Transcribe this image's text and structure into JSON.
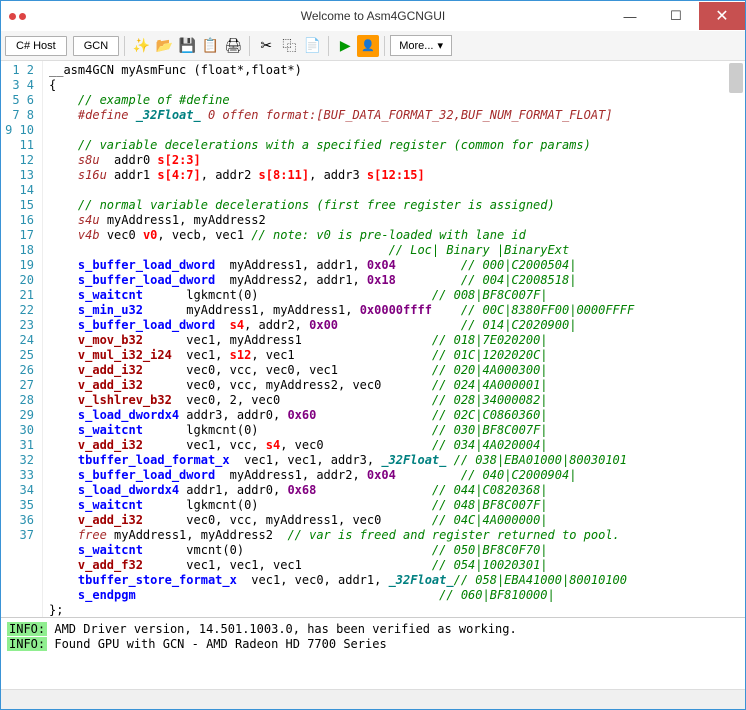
{
  "window": {
    "title": "Welcome to Asm4GCNGUI"
  },
  "toolbar": {
    "tab1": "C# Host",
    "tab2": "GCN",
    "more": "More..."
  },
  "gutter_max": 37,
  "code_lines": [
    [
      {
        "t": "__asm4GCN myAsmFunc (float*,float*)",
        "c": ""
      }
    ],
    [
      {
        "t": "{",
        "c": ""
      }
    ],
    [
      {
        "t": "    ",
        "c": ""
      },
      {
        "t": "// example of #define",
        "c": "sc-green"
      }
    ],
    [
      {
        "t": "    ",
        "c": ""
      },
      {
        "t": "#define ",
        "c": "sc-brown"
      },
      {
        "t": "_32Float_",
        "c": "sc-teal"
      },
      {
        "t": " 0 offen format:[BUF_DATA_FORMAT_32,BUF_NUM_FORMAT_FLOAT]",
        "c": "sc-brown"
      }
    ],
    [
      {
        "t": "",
        "c": ""
      }
    ],
    [
      {
        "t": "    ",
        "c": ""
      },
      {
        "t": "// variable decelerations with a specified register (common for params)",
        "c": "sc-green"
      }
    ],
    [
      {
        "t": "    ",
        "c": ""
      },
      {
        "t": "s8u",
        "c": "sc-brown"
      },
      {
        "t": "  addr0 ",
        "c": ""
      },
      {
        "t": "s[2:3]",
        "c": "sc-s"
      }
    ],
    [
      {
        "t": "    ",
        "c": ""
      },
      {
        "t": "s16u",
        "c": "sc-brown"
      },
      {
        "t": " addr1 ",
        "c": ""
      },
      {
        "t": "s[4:7]",
        "c": "sc-s"
      },
      {
        "t": ", addr2 ",
        "c": ""
      },
      {
        "t": "s[8:11]",
        "c": "sc-s"
      },
      {
        "t": ", addr3 ",
        "c": ""
      },
      {
        "t": "s[12:15]",
        "c": "sc-s"
      }
    ],
    [
      {
        "t": "",
        "c": ""
      }
    ],
    [
      {
        "t": "    ",
        "c": ""
      },
      {
        "t": "// normal variable decelerations (first free register is assigned)",
        "c": "sc-green"
      }
    ],
    [
      {
        "t": "    ",
        "c": ""
      },
      {
        "t": "s4u",
        "c": "sc-brown"
      },
      {
        "t": " myAddress1, myAddress2",
        "c": ""
      }
    ],
    [
      {
        "t": "    ",
        "c": ""
      },
      {
        "t": "v4b",
        "c": "sc-brown"
      },
      {
        "t": " vec0 ",
        "c": ""
      },
      {
        "t": "v0",
        "c": "sc-s"
      },
      {
        "t": ", vecb, vec1 ",
        "c": ""
      },
      {
        "t": "// note: v0 is pre-loaded with lane id",
        "c": "sc-green"
      }
    ],
    [
      {
        "t": "                                               ",
        "c": ""
      },
      {
        "t": "// Loc| Binary |BinaryExt",
        "c": "sc-green"
      }
    ],
    [
      {
        "t": "    ",
        "c": ""
      },
      {
        "t": "s_buffer_load_dword",
        "c": "sc-kw"
      },
      {
        "t": "  myAddress1, addr1, ",
        "c": ""
      },
      {
        "t": "0x04",
        "c": "sc-num"
      },
      {
        "t": "         ",
        "c": ""
      },
      {
        "t": "// 000|C2000504|",
        "c": "sc-green"
      }
    ],
    [
      {
        "t": "    ",
        "c": ""
      },
      {
        "t": "s_buffer_load_dword",
        "c": "sc-kw"
      },
      {
        "t": "  myAddress2, addr1, ",
        "c": ""
      },
      {
        "t": "0x18",
        "c": "sc-num"
      },
      {
        "t": "         ",
        "c": ""
      },
      {
        "t": "// 004|C2008518|",
        "c": "sc-green"
      }
    ],
    [
      {
        "t": "    ",
        "c": ""
      },
      {
        "t": "s_waitcnt",
        "c": "sc-kw"
      },
      {
        "t": "      lgkmcnt(0)                        ",
        "c": ""
      },
      {
        "t": "// 008|BF8C007F|",
        "c": "sc-green"
      }
    ],
    [
      {
        "t": "    ",
        "c": ""
      },
      {
        "t": "s_min_u32",
        "c": "sc-kw"
      },
      {
        "t": "      myAddress1, myAddress1, ",
        "c": ""
      },
      {
        "t": "0x0000ffff",
        "c": "sc-num"
      },
      {
        "t": "    ",
        "c": ""
      },
      {
        "t": "// 00C|8380FF00|0000FFFF",
        "c": "sc-green"
      }
    ],
    [
      {
        "t": "    ",
        "c": ""
      },
      {
        "t": "s_buffer_load_dword",
        "c": "sc-kw"
      },
      {
        "t": "  ",
        "c": ""
      },
      {
        "t": "s4",
        "c": "sc-s"
      },
      {
        "t": ", addr2, ",
        "c": ""
      },
      {
        "t": "0x00",
        "c": "sc-num"
      },
      {
        "t": "                 ",
        "c": ""
      },
      {
        "t": "// 014|C2020900|",
        "c": "sc-green"
      }
    ],
    [
      {
        "t": "    ",
        "c": ""
      },
      {
        "t": "v_mov_b32",
        "c": "sc-red"
      },
      {
        "t": "      vec1, myAddress1                  ",
        "c": ""
      },
      {
        "t": "// 018|7E020200|",
        "c": "sc-green"
      }
    ],
    [
      {
        "t": "    ",
        "c": ""
      },
      {
        "t": "v_mul_i32_i24",
        "c": "sc-red"
      },
      {
        "t": "  vec1, ",
        "c": ""
      },
      {
        "t": "s12",
        "c": "sc-s"
      },
      {
        "t": ", vec1                   ",
        "c": ""
      },
      {
        "t": "// 01C|1202020C|",
        "c": "sc-green"
      }
    ],
    [
      {
        "t": "    ",
        "c": ""
      },
      {
        "t": "v_add_i32",
        "c": "sc-red"
      },
      {
        "t": "      vec0, vcc, vec0, vec1             ",
        "c": ""
      },
      {
        "t": "// 020|4A000300|",
        "c": "sc-green"
      }
    ],
    [
      {
        "t": "    ",
        "c": ""
      },
      {
        "t": "v_add_i32",
        "c": "sc-red"
      },
      {
        "t": "      vec0, vcc, myAddress2, vec0       ",
        "c": ""
      },
      {
        "t": "// 024|4A000001|",
        "c": "sc-green"
      }
    ],
    [
      {
        "t": "    ",
        "c": ""
      },
      {
        "t": "v_lshlrev_b32",
        "c": "sc-red"
      },
      {
        "t": "  vec0, 2, vec0                     ",
        "c": ""
      },
      {
        "t": "// 028|34000082|",
        "c": "sc-green"
      }
    ],
    [
      {
        "t": "    ",
        "c": ""
      },
      {
        "t": "s_load_dwordx4",
        "c": "sc-kw"
      },
      {
        "t": " addr3, addr0, ",
        "c": ""
      },
      {
        "t": "0x60",
        "c": "sc-num"
      },
      {
        "t": "                ",
        "c": ""
      },
      {
        "t": "// 02C|C0860360|",
        "c": "sc-green"
      }
    ],
    [
      {
        "t": "    ",
        "c": ""
      },
      {
        "t": "s_waitcnt",
        "c": "sc-kw"
      },
      {
        "t": "      lgkmcnt(0)                        ",
        "c": ""
      },
      {
        "t": "// 030|BF8C007F|",
        "c": "sc-green"
      }
    ],
    [
      {
        "t": "    ",
        "c": ""
      },
      {
        "t": "v_add_i32",
        "c": "sc-red"
      },
      {
        "t": "      vec1, vcc, ",
        "c": ""
      },
      {
        "t": "s4",
        "c": "sc-s"
      },
      {
        "t": ", vec0               ",
        "c": ""
      },
      {
        "t": "// 034|4A020004|",
        "c": "sc-green"
      }
    ],
    [
      {
        "t": "    ",
        "c": ""
      },
      {
        "t": "tbuffer_load_format_x",
        "c": "sc-kw"
      },
      {
        "t": "  vec1, vec1, addr3, ",
        "c": ""
      },
      {
        "t": "_32Float_",
        "c": "sc-teal"
      },
      {
        "t": " ",
        "c": ""
      },
      {
        "t": "// 038|EBA01000|80030101",
        "c": "sc-green"
      }
    ],
    [
      {
        "t": "    ",
        "c": ""
      },
      {
        "t": "s_buffer_load_dword",
        "c": "sc-kw"
      },
      {
        "t": "  myAddress1, addr2, ",
        "c": ""
      },
      {
        "t": "0x04",
        "c": "sc-num"
      },
      {
        "t": "         ",
        "c": ""
      },
      {
        "t": "// 040|C2000904|",
        "c": "sc-green"
      }
    ],
    [
      {
        "t": "    ",
        "c": ""
      },
      {
        "t": "s_load_dwordx4",
        "c": "sc-kw"
      },
      {
        "t": " addr1, addr0, ",
        "c": ""
      },
      {
        "t": "0x68",
        "c": "sc-num"
      },
      {
        "t": "                ",
        "c": ""
      },
      {
        "t": "// 044|C0820368|",
        "c": "sc-green"
      }
    ],
    [
      {
        "t": "    ",
        "c": ""
      },
      {
        "t": "s_waitcnt",
        "c": "sc-kw"
      },
      {
        "t": "      lgkmcnt(0)                        ",
        "c": ""
      },
      {
        "t": "// 048|BF8C007F|",
        "c": "sc-green"
      }
    ],
    [
      {
        "t": "    ",
        "c": ""
      },
      {
        "t": "v_add_i32",
        "c": "sc-red"
      },
      {
        "t": "      vec0, vcc, myAddress1, vec0       ",
        "c": ""
      },
      {
        "t": "// 04C|4A000000|",
        "c": "sc-green"
      }
    ],
    [
      {
        "t": "    ",
        "c": ""
      },
      {
        "t": "free",
        "c": "sc-brown"
      },
      {
        "t": " myAddress1, myAddress2  ",
        "c": ""
      },
      {
        "t": "// var is freed and register returned to pool.",
        "c": "sc-green"
      }
    ],
    [
      {
        "t": "    ",
        "c": ""
      },
      {
        "t": "s_waitcnt",
        "c": "sc-kw"
      },
      {
        "t": "      vmcnt(0)                          ",
        "c": ""
      },
      {
        "t": "// 050|BF8C0F70|",
        "c": "sc-green"
      }
    ],
    [
      {
        "t": "    ",
        "c": ""
      },
      {
        "t": "v_add_f32",
        "c": "sc-red"
      },
      {
        "t": "      vec1, vec1, vec1                  ",
        "c": ""
      },
      {
        "t": "// 054|10020301|",
        "c": "sc-green"
      }
    ],
    [
      {
        "t": "    ",
        "c": ""
      },
      {
        "t": "tbuffer_store_format_x",
        "c": "sc-kw"
      },
      {
        "t": "  vec1, vec0, addr1, ",
        "c": ""
      },
      {
        "t": "_32Float_",
        "c": "sc-teal"
      },
      {
        "t": "",
        "c": ""
      },
      {
        "t": "// 058|EBA41000|80010100",
        "c": "sc-green"
      }
    ],
    [
      {
        "t": "    ",
        "c": ""
      },
      {
        "t": "s_endpgm",
        "c": "sc-kw"
      },
      {
        "t": "                                          ",
        "c": ""
      },
      {
        "t": "// 060|BF810000|",
        "c": "sc-green"
      }
    ],
    [
      {
        "t": "};",
        "c": ""
      }
    ]
  ],
  "output": {
    "badge": "INFO:",
    "line1": " AMD Driver version, 14.501.1003.0, has been verified as working.",
    "line2": " Found GPU with GCN - AMD Radeon HD 7700 Series"
  }
}
